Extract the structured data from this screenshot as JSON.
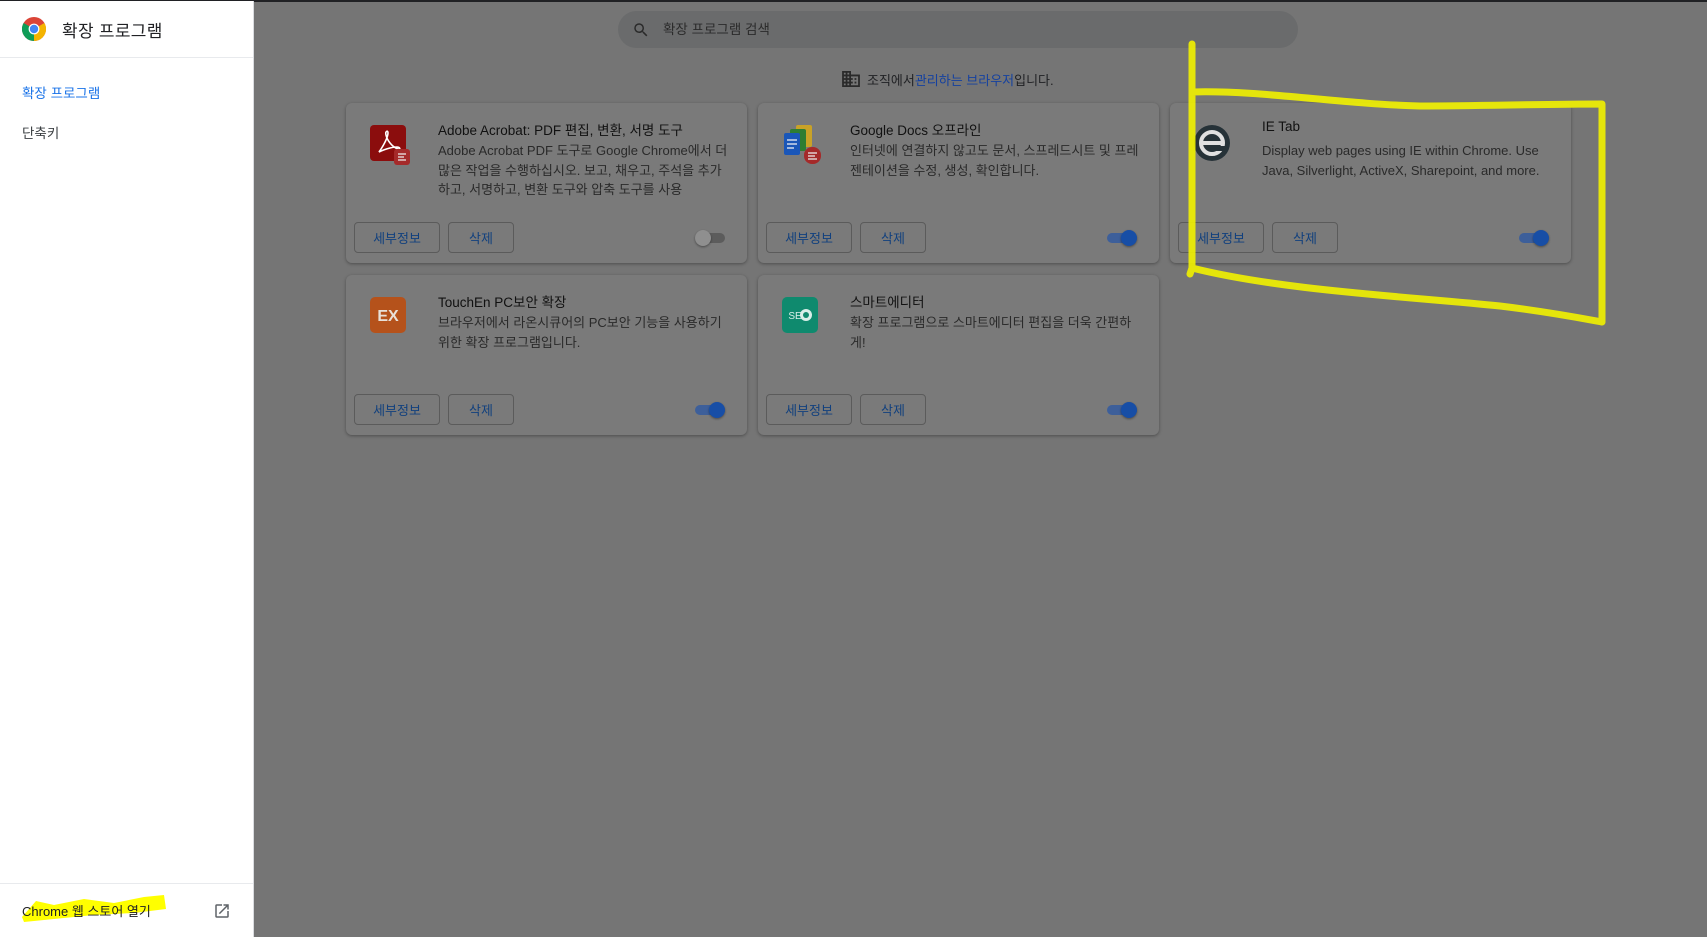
{
  "sidebar": {
    "title": "확장 프로그램",
    "items": [
      {
        "label": "확장 프로그램",
        "active": true
      },
      {
        "label": "단축키",
        "active": false
      }
    ],
    "footer_link": "Chrome 웹 스토어 열기"
  },
  "search": {
    "placeholder": "확장 프로그램 검색",
    "value": ""
  },
  "managed": {
    "prefix": "조직에서 ",
    "link": "관리하는 브라우저",
    "suffix": "입니다."
  },
  "extensions": [
    {
      "name": "Adobe Acrobat: PDF 편집, 변환, 서명 도구",
      "description": "Adobe Acrobat PDF 도구로 Google Chrome에서 더 많은 작업을 수행하십시오. 보고, 채우고, 주석을 추가하고, 서명하고, 변환 도구와 압축 도구를 사용",
      "details_label": "세부정보",
      "remove_label": "삭제",
      "enabled": false,
      "icon": "acrobat-icon"
    },
    {
      "name": "Google Docs 오프라인",
      "description": "인터넷에 연결하지 않고도 문서, 스프레드시트 및 프레젠테이션을 수정, 생성, 확인합니다.",
      "details_label": "세부정보",
      "remove_label": "삭제",
      "enabled": true,
      "icon": "google-docs-icon"
    },
    {
      "name": "IE Tab",
      "description": "Display web pages using IE within Chrome. Use Java, Silverlight, ActiveX, Sharepoint, and more.",
      "details_label": "세부정보",
      "remove_label": "삭제",
      "enabled": true,
      "icon": "ie-tab-icon"
    },
    {
      "name": "TouchEn PC보안 확장",
      "description": "브라우저에서 라온시큐어의 PC보안 기능을 사용하기 위한 확장 프로그램입니다.",
      "details_label": "세부정보",
      "remove_label": "삭제",
      "enabled": true,
      "icon": "touchen-ex-icon"
    },
    {
      "name": "스마트에디터",
      "description": "확장 프로그램으로 스마트에디터 편집을 더욱 간편하게!",
      "details_label": "세부정보",
      "remove_label": "삭제",
      "enabled": true,
      "icon": "smarteditor-icon"
    }
  ],
  "icon_text": {
    "touchen": "EX",
    "smarteditor": "SE"
  },
  "colors": {
    "accent": "#1a73e8",
    "highlight": "#ffff00",
    "overlay": "#757575"
  }
}
